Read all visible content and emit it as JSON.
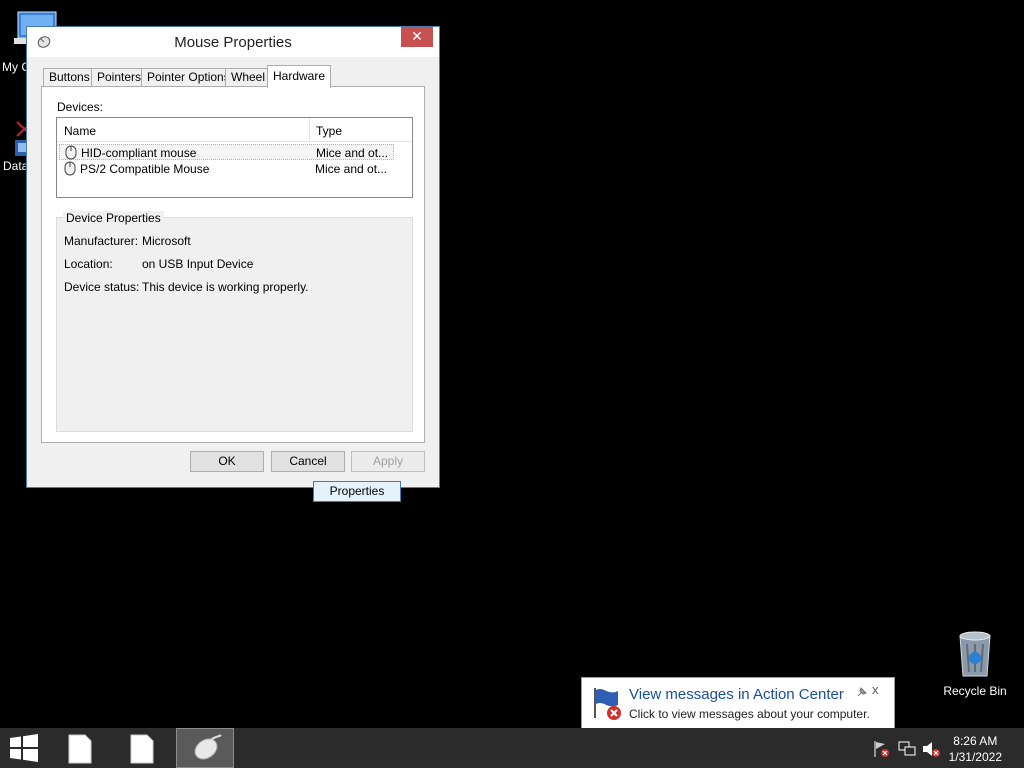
{
  "desktop": {
    "icons": [
      {
        "label": "My C",
        "name": "my-computer"
      },
      {
        "label": "Data",
        "name": "data"
      },
      {
        "label": "Recycle Bin",
        "name": "recycle-bin"
      }
    ]
  },
  "dialog": {
    "title": "Mouse Properties",
    "close_glyph": "✕",
    "tabs": [
      "Buttons",
      "Pointers",
      "Pointer Options",
      "Wheel",
      "Hardware"
    ],
    "active_tab": "Hardware",
    "devices_label": "Devices:",
    "columns": [
      "Name",
      "Type"
    ],
    "devices": [
      {
        "name": "HID-compliant mouse",
        "type": "Mice and ot...",
        "selected": true
      },
      {
        "name": "PS/2 Compatible Mouse",
        "type": "Mice and ot...",
        "selected": false
      }
    ],
    "device_properties": {
      "title": "Device Properties",
      "manufacturer_label": "Manufacturer:",
      "manufacturer": "Microsoft",
      "location_label": "Location:",
      "location": "on USB Input Device",
      "status_label": "Device status:",
      "status": "This device is working properly.",
      "properties_button": "Properties"
    },
    "buttons": {
      "ok": "OK",
      "cancel": "Cancel",
      "apply": "Apply"
    }
  },
  "balloon": {
    "title": "View messages in Action Center",
    "body": "Click to view messages about your computer.",
    "close_glyph": "x"
  },
  "taskbar": {
    "time": "8:26 AM",
    "date": "1/31/2022"
  },
  "colors": {
    "desktop": "#000000",
    "taskbar": "#2b2b2b",
    "close_button": "#c75050",
    "balloon_title": "#1a4f9c"
  }
}
